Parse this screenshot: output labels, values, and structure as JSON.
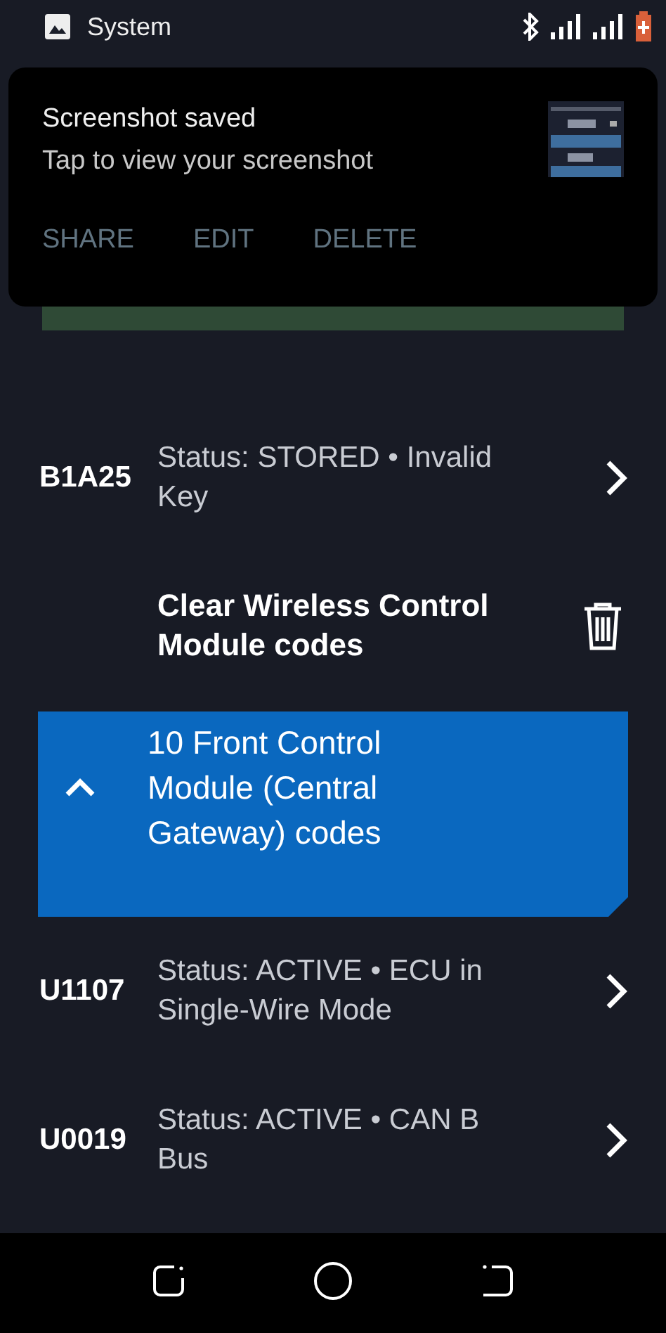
{
  "status_bar": {
    "app_label": "System"
  },
  "notification": {
    "title": "Screenshot saved",
    "message": "Tap to view your screenshot",
    "actions": [
      "SHARE",
      "EDIT",
      "DELETE"
    ]
  },
  "list": [
    {
      "kind": "code",
      "code": "B1A25",
      "status": "Status: STORED • Invalid Key"
    },
    {
      "kind": "clear",
      "label": "Clear Wireless Control Module codes"
    },
    {
      "kind": "module",
      "label": "10 Front Control Module (Central Gateway) codes",
      "expanded": true
    },
    {
      "kind": "code",
      "code": "U1107",
      "status": "Status: ACTIVE • ECU in Single-Wire Mode"
    },
    {
      "kind": "code",
      "code": "U0019",
      "status": "Status: ACTIVE • CAN B Bus"
    }
  ]
}
